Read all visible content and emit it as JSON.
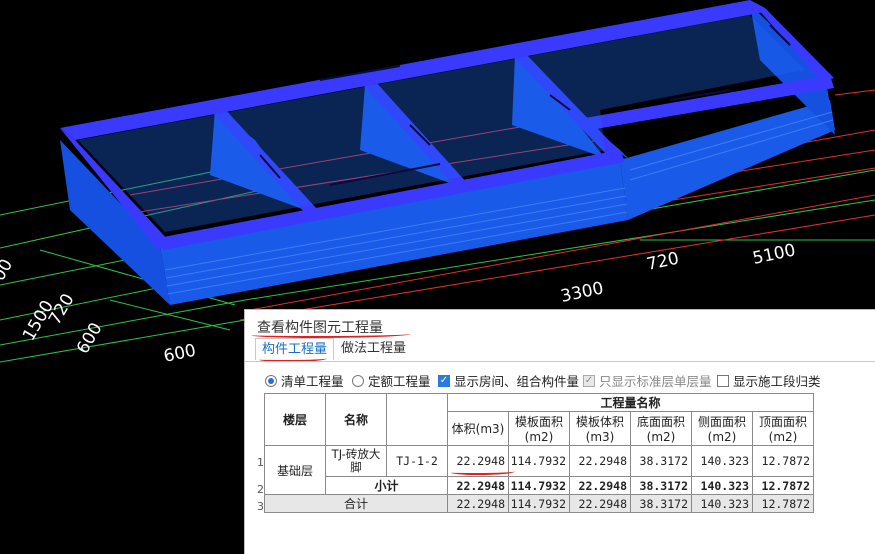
{
  "dimensions": {
    "d_720a": "720",
    "d_5100": "5100",
    "d_3300": "3300",
    "d_720b": "720",
    "d_1500": "1500",
    "d_600a": "600",
    "d_600b": "600",
    "d_00": "00"
  },
  "panel": {
    "title": "查看构件图元工程量",
    "tabs": [
      "构件工程量",
      "做法工程量"
    ],
    "options": {
      "radio_list": "清单工程量",
      "radio_quota": "定额工程量",
      "chk_rooms": "显示房间、组合构件量",
      "chk_std_floor": "只显示标准层单层量",
      "chk_stage": "显示施工段归类"
    },
    "table": {
      "group_header": "工程量名称",
      "col_floor": "楼层",
      "col_name": "名称",
      "columns": [
        "体积(m3)",
        "模板面积(m2)",
        "模板体积(m3)",
        "底面面积(m2)",
        "侧面面积(m2)",
        "顶面面积(m2)"
      ],
      "row1": {
        "num": "1",
        "floor": "基础层",
        "name": "TJ-砖放大脚",
        "code": "TJ-1-2",
        "values": [
          "22.2948",
          "114.7932",
          "22.2948",
          "38.3172",
          "140.323",
          "12.7872"
        ]
      },
      "row2": {
        "num": "2",
        "label": "小计",
        "values": [
          "22.2948",
          "114.7932",
          "22.2948",
          "38.3172",
          "140.323",
          "12.7872"
        ]
      },
      "row3": {
        "num": "3",
        "label": "合计",
        "values": [
          "22.2948",
          "114.7932",
          "22.2948",
          "38.3172",
          "140.323",
          "12.7872"
        ]
      }
    }
  },
  "colors": {
    "beam_top": "#3b3bff",
    "beam_side": "#1f5fe6",
    "grid_green": "#2fc24a",
    "grid_red": "#e03030",
    "annotation_red": "#e02020",
    "accent_blue": "#1a6fc4"
  }
}
